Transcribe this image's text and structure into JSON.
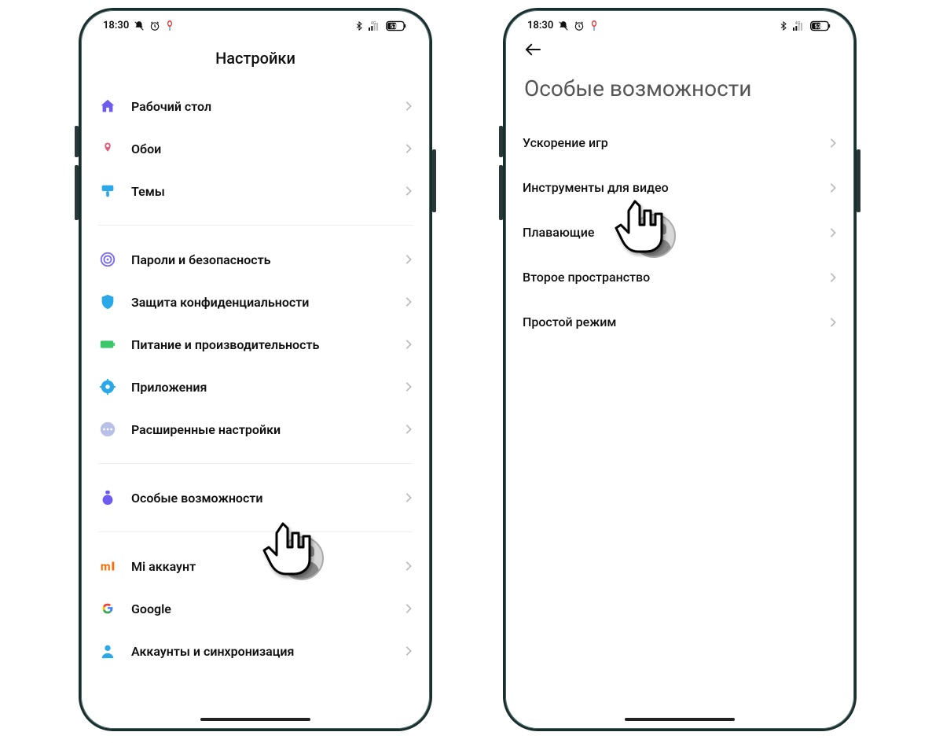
{
  "status": {
    "time": "18:30",
    "battery": "53"
  },
  "left": {
    "title": "Настройки",
    "groups": [
      {
        "items": [
          {
            "icon": "home",
            "color": "#6e5cf0",
            "label": "Рабочий стол"
          },
          {
            "icon": "wallpaper",
            "color": "#e05a7a",
            "label": "Обои"
          },
          {
            "icon": "brush",
            "color": "#2aa8e8",
            "label": "Темы"
          }
        ]
      },
      {
        "items": [
          {
            "icon": "fingerprint",
            "color": "#7a6bf4",
            "label": "Пароли и безопасность"
          },
          {
            "icon": "shield",
            "color": "#2aa8e8",
            "label": "Защита конфиденциальности"
          },
          {
            "icon": "battery",
            "color": "#3cc86a",
            "label": "Питание и производительность"
          },
          {
            "icon": "gear",
            "color": "#2aa8e8",
            "label": "Приложения"
          },
          {
            "icon": "dots",
            "color": "#b8c0e8",
            "label": "Расширенные настройки"
          }
        ]
      },
      {
        "items": [
          {
            "icon": "flask",
            "color": "#6e5cf0",
            "label": "Особые возможности"
          }
        ]
      },
      {
        "items": [
          {
            "icon": "mi",
            "color": "#ff6a00",
            "label": "Mi аккаунт"
          },
          {
            "icon": "google",
            "color": "multi",
            "label": "Google"
          },
          {
            "icon": "person",
            "color": "#2aa8e8",
            "label": "Аккаунты и синхронизация"
          }
        ]
      }
    ]
  },
  "right": {
    "title": "Особые возможности",
    "items": [
      {
        "label": "Ускорение игр"
      },
      {
        "label": "Инструменты для видео"
      },
      {
        "label": "Плавающие"
      },
      {
        "label": "Второе пространство"
      },
      {
        "label": "Простой режим"
      }
    ]
  }
}
